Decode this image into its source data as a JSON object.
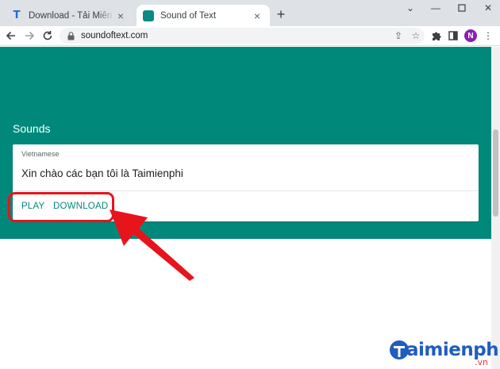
{
  "browser": {
    "tabs": [
      {
        "title": "Download - Tải Miễn Phí VN - Pl",
        "favicon": "taimienphi-t-icon"
      },
      {
        "title": "Sound of Text",
        "favicon": "sound-of-text-icon"
      }
    ],
    "address": {
      "url": "soundoftext.com"
    },
    "profile_initial": "N"
  },
  "page": {
    "section_title": "Sounds",
    "sound_card": {
      "language": "Vietnamese",
      "text": "Xin chào các bạn tôi là Taimienphi",
      "play_label": "PLAY",
      "download_label": "DOWNLOAD"
    }
  },
  "annotation": {
    "color": "#e8141b"
  },
  "watermark": {
    "brand": "aimienphi",
    "tld": ".vn"
  },
  "colors": {
    "teal": "#00897b",
    "chrome_bg": "#dee1e6"
  }
}
